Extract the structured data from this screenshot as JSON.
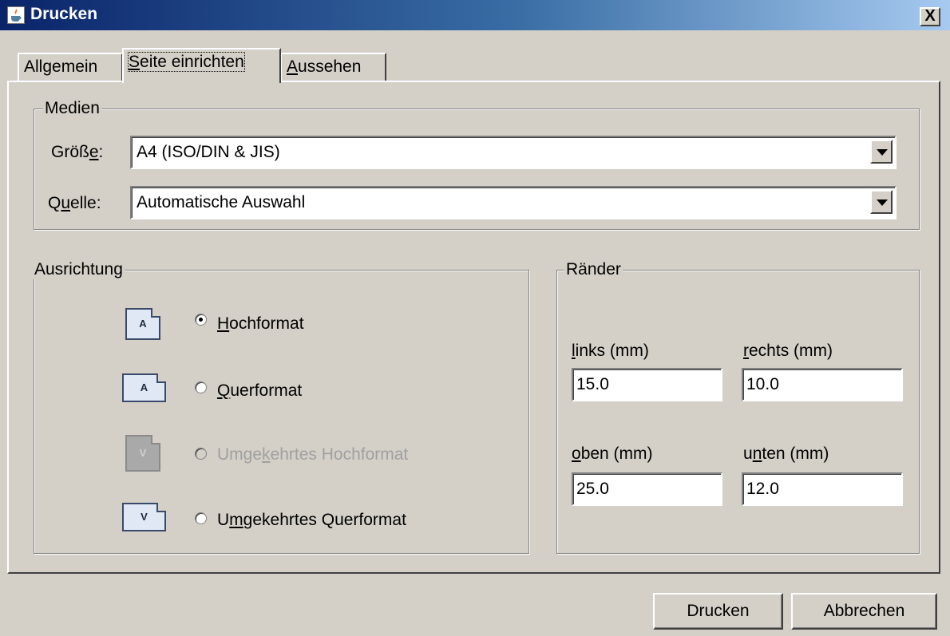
{
  "window": {
    "title": "Drucken",
    "close_glyph": "X",
    "icon": "java-icon"
  },
  "tabs": [
    {
      "label": "Allgemein",
      "mnemonic": "g",
      "selected": false
    },
    {
      "label": "Seite einrichten",
      "mnemonic": "S",
      "selected": true
    },
    {
      "label": "Aussehen",
      "mnemonic": "A",
      "selected": false
    }
  ],
  "media": {
    "legend": "Medien",
    "size_label": "Größe:",
    "size_value": "A4 (ISO/DIN & JIS)",
    "source_label": "Quelle:",
    "source_value": "Automatische Auswahl"
  },
  "orientation": {
    "legend": "Ausrichtung",
    "options": [
      {
        "label": "Hochformat",
        "icon_letter": "A",
        "checked": true,
        "enabled": true
      },
      {
        "label": "Querformat",
        "icon_letter": "A",
        "checked": false,
        "enabled": true
      },
      {
        "label": "Umgekehrtes Hochformat",
        "icon_letter": "V",
        "checked": false,
        "enabled": false
      },
      {
        "label": "Umgekehrtes Querformat",
        "icon_letter": "V",
        "checked": false,
        "enabled": true
      }
    ]
  },
  "margins": {
    "legend": "Ränder",
    "left_label": "links (mm)",
    "left_value": "15.0",
    "right_label": "rechts (mm)",
    "right_value": "10.0",
    "top_label": "oben (mm)",
    "top_value": "25.0",
    "bottom_label": "unten (mm)",
    "bottom_value": "12.0"
  },
  "buttons": {
    "print": "Drucken",
    "cancel": "Abbrechen"
  },
  "colors": {
    "titlebar_start": "#0a246a",
    "titlebar_end": "#a6caf0",
    "window_bg": "#d4d0c8"
  }
}
